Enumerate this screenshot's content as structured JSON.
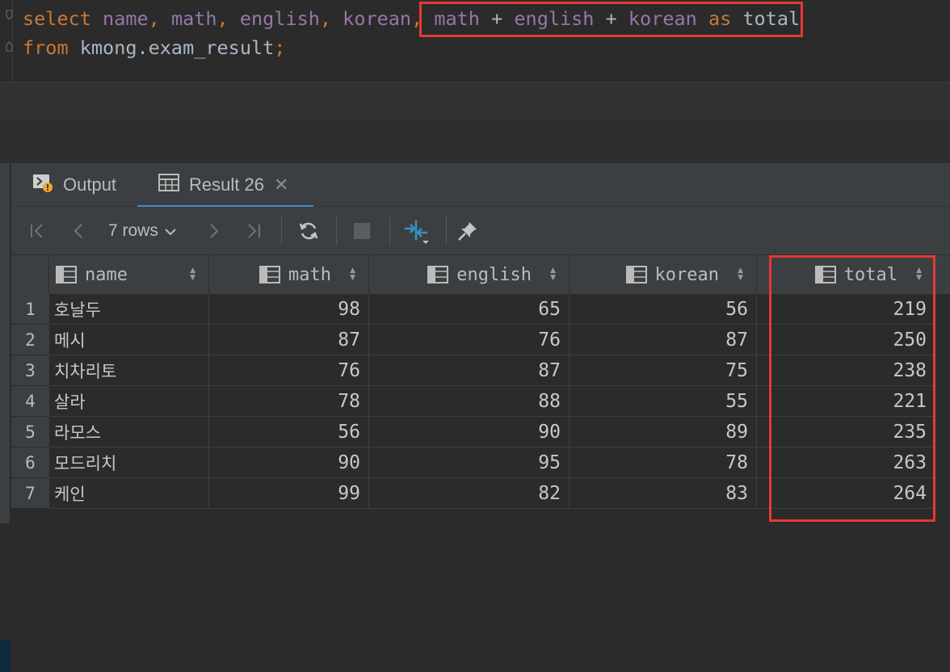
{
  "editor": {
    "line1": [
      {
        "t": "select",
        "c": "kw"
      },
      {
        "t": " ",
        "c": "plain"
      },
      {
        "t": "name",
        "c": "col"
      },
      {
        "t": ", ",
        "c": "punct"
      },
      {
        "t": "math",
        "c": "col"
      },
      {
        "t": ", ",
        "c": "punct"
      },
      {
        "t": "english",
        "c": "col"
      },
      {
        "t": ", ",
        "c": "punct"
      },
      {
        "t": "korean",
        "c": "col"
      },
      {
        "t": ", ",
        "c": "punct"
      },
      {
        "t": "math",
        "c": "col"
      },
      {
        "t": " + ",
        "c": "plain"
      },
      {
        "t": "english",
        "c": "col"
      },
      {
        "t": " + ",
        "c": "plain"
      },
      {
        "t": "korean",
        "c": "col"
      },
      {
        "t": " ",
        "c": "plain"
      },
      {
        "t": "as",
        "c": "kw"
      },
      {
        "t": " ",
        "c": "plain"
      },
      {
        "t": "total",
        "c": "plain"
      }
    ],
    "line2": [
      {
        "t": "from",
        "c": "kw"
      },
      {
        "t": " ",
        "c": "plain"
      },
      {
        "t": "kmong.exam_result",
        "c": "plain"
      },
      {
        "t": ";",
        "c": "punct"
      }
    ]
  },
  "tabs": {
    "output_label": "Output",
    "result_label": "Result 26"
  },
  "toolbar": {
    "rows_label": "7 rows"
  },
  "grid": {
    "columns": [
      "name",
      "math",
      "english",
      "korean",
      "total"
    ],
    "rows": [
      {
        "n": "1",
        "name": "호날두",
        "math": "98",
        "english": "65",
        "korean": "56",
        "total": "219"
      },
      {
        "n": "2",
        "name": "메시",
        "math": "87",
        "english": "76",
        "korean": "87",
        "total": "250"
      },
      {
        "n": "3",
        "name": "치차리토",
        "math": "76",
        "english": "87",
        "korean": "75",
        "total": "238"
      },
      {
        "n": "4",
        "name": "살라",
        "math": "78",
        "english": "88",
        "korean": "55",
        "total": "221"
      },
      {
        "n": "5",
        "name": "라모스",
        "math": "56",
        "english": "90",
        "korean": "89",
        "total": "235"
      },
      {
        "n": "6",
        "name": "모드리치",
        "math": "90",
        "english": "95",
        "korean": "78",
        "total": "263"
      },
      {
        "n": "7",
        "name": "케인",
        "math": "99",
        "english": "82",
        "korean": "83",
        "total": "264"
      }
    ]
  },
  "colors": {
    "highlight": "#e53935",
    "keyword": "#cc7832",
    "column": "#9876aa",
    "accent": "#4a88c7"
  },
  "icons": [
    "fold-icon",
    "output-icon",
    "table-icon",
    "close-icon",
    "first-page-icon",
    "prev-page-icon",
    "chevron-down-icon",
    "next-page-icon",
    "last-page-icon",
    "refresh-icon",
    "stop-icon",
    "compare-icon",
    "pin-icon",
    "sort-icon"
  ]
}
